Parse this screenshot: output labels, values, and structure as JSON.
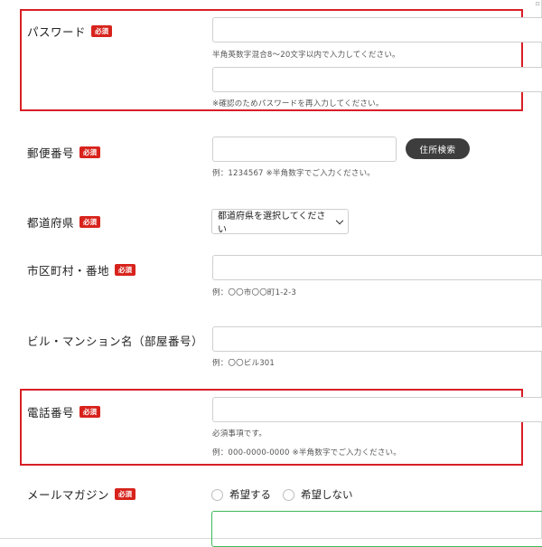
{
  "required_badge": "必須",
  "password": {
    "label": "パスワード",
    "hint": "半角英数字混合8～20文字以内で入力してください。",
    "confirm_hint": "※確認のためパスワードを再入力してください。"
  },
  "postal": {
    "label": "郵便番号",
    "search_button": "住所検索",
    "hint": "例：1234567 ※半角数字でご入力ください。"
  },
  "prefecture": {
    "label": "都道府県",
    "selected": "都道府県を選択してください"
  },
  "city": {
    "label": "市区町村・番地",
    "hint": "例：〇〇市〇〇町1-2-3"
  },
  "building": {
    "label": "ビル・マンション名（部屋番号）",
    "hint": "例：〇〇ビル301"
  },
  "phone": {
    "label": "電話番号",
    "hint_required": "必須事項です。",
    "hint_example": "例：000-0000-0000 ※半角数字でご入力ください。"
  },
  "newsletter": {
    "label": "メールマガジン",
    "option_yes": "希望する",
    "option_no": "希望しない"
  },
  "colors": {
    "required_badge": "#d7231c",
    "highlight_border": "#d81f26",
    "button_dark": "#3d3d3d",
    "newsletter_box_border": "#3fb85a"
  }
}
